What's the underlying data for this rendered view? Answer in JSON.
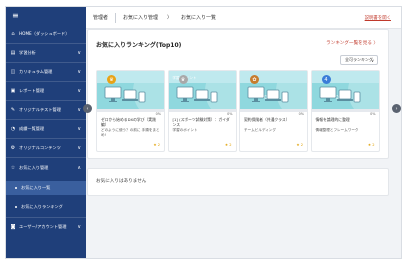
{
  "sidebar": {
    "menu_icon": "hamburger-icon",
    "items": [
      {
        "label": "HOME（ダッシュボード）",
        "icon": "home-icon",
        "glyph": "⌂"
      },
      {
        "label": "学習分析",
        "icon": "chart-icon",
        "glyph": "▤",
        "chevron": "∨"
      },
      {
        "label": "カリキュラム管理",
        "icon": "curriculum-icon",
        "glyph": "◫",
        "chevron": "∨"
      },
      {
        "label": "レポート管理",
        "icon": "report-icon",
        "glyph": "▣",
        "chevron": "∨"
      },
      {
        "label": "オリジナルテスト管理",
        "icon": "test-icon",
        "glyph": "✎",
        "chevron": "∨"
      },
      {
        "label": "成績一覧管理",
        "icon": "grade-icon",
        "glyph": "◔",
        "chevron": "∨"
      },
      {
        "label": "オリジナルコンテンツ",
        "icon": "content-icon",
        "glyph": "⚙",
        "chevron": "∨"
      },
      {
        "label": "お気に入り管理",
        "icon": "star-icon",
        "glyph": "☆",
        "chevron": "∧"
      }
    ],
    "sub_items": [
      {
        "label": "お気に入り一覧"
      },
      {
        "label": "お気に入りランキング"
      }
    ],
    "last_item": {
      "label": "ユーザー/アカウント管理",
      "icon": "user-icon",
      "glyph": "◙",
      "chevron": "∨"
    }
  },
  "header": {
    "crumbs": [
      "管理者",
      "お気に入り管理",
      "お気に入り一覧"
    ],
    "separator": "〉",
    "help_link": "説明書を開く"
  },
  "ranking": {
    "title": "お気に入りランキング(Top10)",
    "more_link": "ランキング一覧を見る 〉",
    "sort_label": "全可ランキング",
    "sort_arrow": "∨",
    "prev": "‹",
    "next": "›",
    "cards": [
      {
        "rank_badge": "crown-gold",
        "badge_color": "#e8a317",
        "badge_glyph": "♛",
        "thumb_text": "",
        "big": "",
        "progress": 0,
        "progress_label": "0%",
        "title": "ゼロから始めるDXの学び（実践編）",
        "subtitle": "どのように使う？の前に 手順をまとめ!",
        "likes": "★ 2"
      },
      {
        "rank_badge": "crown-silver",
        "badge_color": "#a9a9a9",
        "badge_glyph": "♛",
        "thumb_text": "学習のポイント",
        "big": "",
        "progress": 0,
        "progress_label": "0%",
        "title": "[1] (スポーツ試験対策）：ガイダンス",
        "subtitle": "学習のポイント",
        "likes": "★ 2"
      },
      {
        "rank_badge": "medal-bronze",
        "badge_color": "#c77d2e",
        "badge_glyph": "✿",
        "thumb_text": "",
        "big": "02",
        "progress": 0,
        "progress_label": "0%",
        "title": "契約保険者（共通クラス）",
        "subtitle": "チームビルディング",
        "likes": "★ 2"
      },
      {
        "rank_badge": "number",
        "badge_color": "#3b7dd8",
        "badge_glyph": "4",
        "thumb_text": "",
        "big": "02",
        "progress": 0,
        "progress_label": "0%",
        "title": "情報を論理的に整理",
        "subtitle": "情報整理とフレームワーク",
        "likes": "★ 2"
      }
    ]
  },
  "favorites": {
    "empty_text": "お気に入りはありません"
  },
  "colors": {
    "sidebar": "#1f3f7a",
    "accent_link": "#c0392b",
    "thumb": "#8fd8de"
  }
}
